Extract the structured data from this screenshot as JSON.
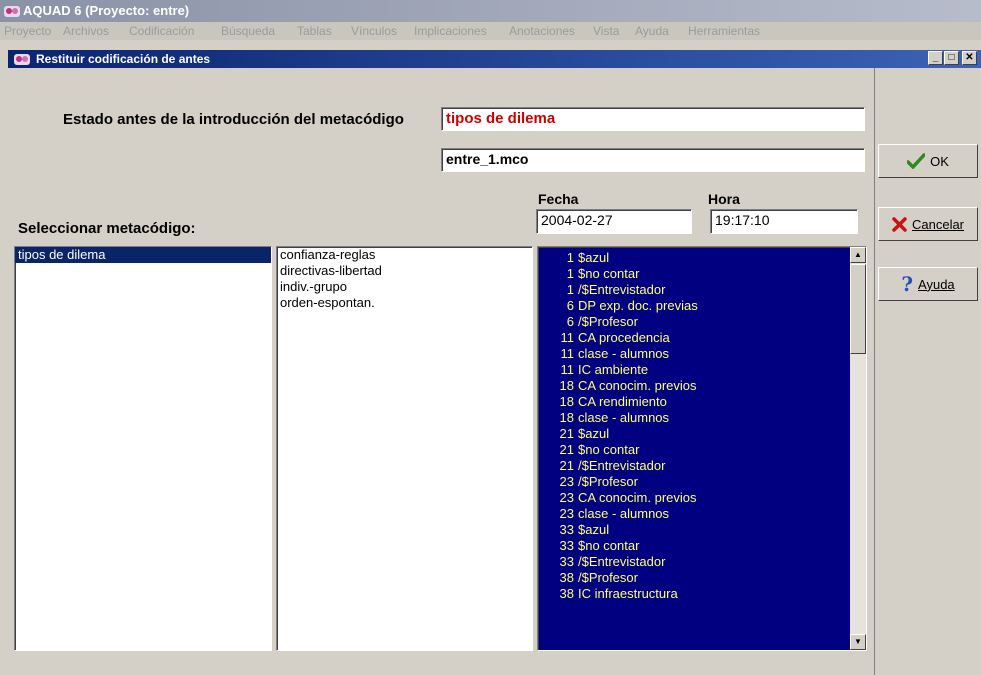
{
  "app": {
    "title": "AQUAD 6 (Proyecto: entre)"
  },
  "menu": [
    "Proyecto",
    "Archivos",
    "Codificación",
    "Búsqueda",
    "Tablas",
    "Vínculos",
    "Implicaciones",
    "Anotaciones",
    "Vista",
    "Ayuda",
    "Herramientas"
  ],
  "dialog": {
    "title": "Restituir codificación de antes",
    "estado_label": "Estado antes de la introducción del metacódigo",
    "metacode_value": "tipos de dilema",
    "file_value": "entre_1.mco",
    "fecha_label": "Fecha",
    "hora_label": "Hora",
    "fecha_value": "2004-02-27",
    "hora_value": "19:17:10",
    "select_label": "Seleccionar metacódigo:",
    "metacodes": [
      "tipos de dilema"
    ],
    "subcodes": [
      "confianza-reglas",
      "directivas-libertad",
      "indiv.-grupo",
      "orden-espontan."
    ],
    "codes": [
      {
        "n": "1",
        "t": "$azul"
      },
      {
        "n": "1",
        "t": "$no contar"
      },
      {
        "n": "1",
        "t": "/$Entrevistador"
      },
      {
        "n": "6",
        "t": "DP exp. doc. previas"
      },
      {
        "n": "6",
        "t": "/$Profesor"
      },
      {
        "n": "11",
        "t": "CA procedencia"
      },
      {
        "n": "11",
        "t": "clase - alumnos"
      },
      {
        "n": "11",
        "t": "IC ambiente"
      },
      {
        "n": "18",
        "t": "CA conocim. previos"
      },
      {
        "n": "18",
        "t": "CA rendimiento"
      },
      {
        "n": "18",
        "t": "clase - alumnos"
      },
      {
        "n": "21",
        "t": "$azul"
      },
      {
        "n": "21",
        "t": "$no contar"
      },
      {
        "n": "21",
        "t": "/$Entrevistador"
      },
      {
        "n": "23",
        "t": "/$Profesor"
      },
      {
        "n": "23",
        "t": "CA conocim. previos"
      },
      {
        "n": "23",
        "t": "clase - alumnos"
      },
      {
        "n": "33",
        "t": "$azul"
      },
      {
        "n": "33",
        "t": "$no contar"
      },
      {
        "n": "33",
        "t": "/$Entrevistador"
      },
      {
        "n": "38",
        "t": "/$Profesor"
      },
      {
        "n": "38",
        "t": "IC infraestructura"
      }
    ]
  },
  "buttons": {
    "ok": "OK",
    "cancel": "Cancelar",
    "help": "Ayuda"
  },
  "colors": {
    "metacode_text": "#cc0000",
    "codes_bg": "#000080",
    "codes_text": "#ffff80",
    "ok_icon": "#2e8b1e",
    "cancel_icon": "#cc1111",
    "help_icon": "#2050c0"
  }
}
